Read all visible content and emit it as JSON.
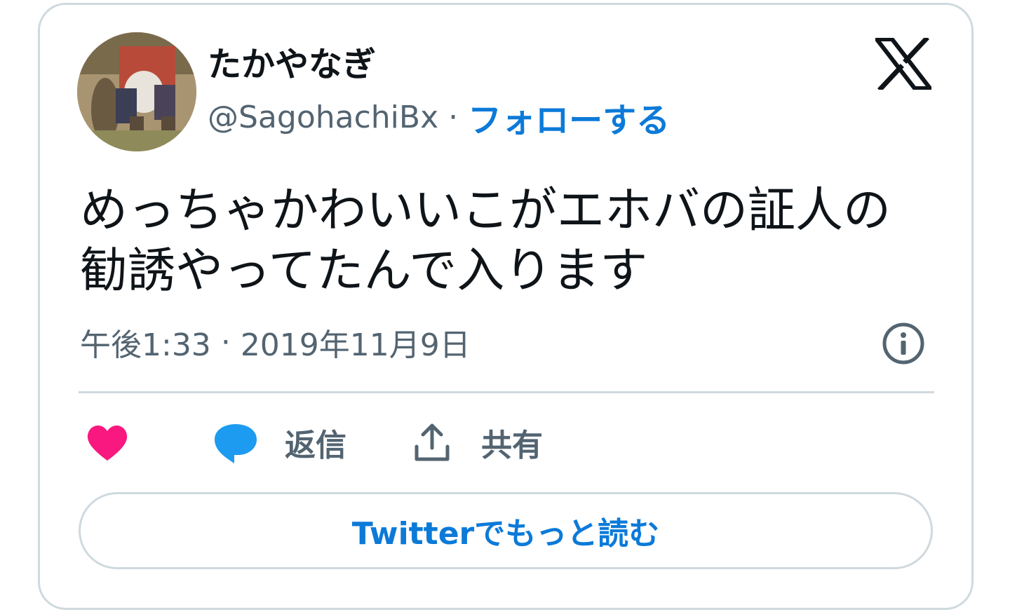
{
  "author": {
    "display_name": "たかやなぎ",
    "handle": "@SagohachiBx",
    "separator": "·",
    "follow_label": "フォローする"
  },
  "tweet": {
    "text_line1": "めっちゃかわいいこがエホバの証人の",
    "text_line2": "勧誘やってたんで入ります",
    "time": "午後1:33",
    "meta_separator": "·",
    "date": "2019年11月9日"
  },
  "actions": {
    "like_label": "",
    "reply_label": "返信",
    "share_label": "共有"
  },
  "read_more_label": "Twitterでもっと読む",
  "icons": {
    "logo": "x-logo-icon",
    "info": "info-icon",
    "like": "heart-icon",
    "reply": "speech-bubble-icon",
    "share": "share-upload-icon"
  },
  "colors": {
    "text_primary": "#0f1419",
    "text_secondary": "#536471",
    "link_blue": "#0c7ad8",
    "heart_pink": "#f91880",
    "reply_blue": "#1d9bf0",
    "border": "#cfd9de"
  }
}
